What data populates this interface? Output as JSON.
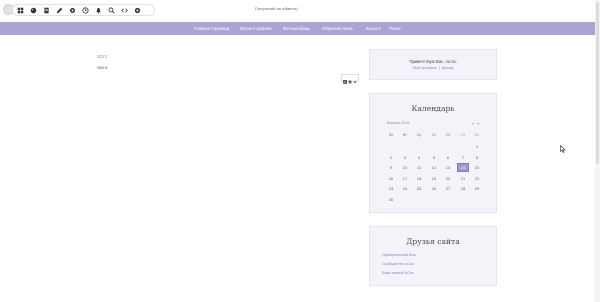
{
  "toolbar": {
    "icons": [
      "dashboard-icon",
      "palette-icon",
      "document-icon",
      "pencil-icon",
      "settings-icon",
      "clock-icon",
      "bell-icon",
      "search-icon",
      "code-icon",
      "eye-icon"
    ],
    "notice": "Получений ни обменіх)"
  },
  "nav": {
    "items": [
      "Главная страница",
      "Каталог файлов",
      "Фотоальбомы",
      "Обратная связь",
      "Каталог",
      "Поиск"
    ]
  },
  "content": {
    "year": "2013",
    "word": "квинк",
    "actions": [
      "rss-icon",
      "print-icon",
      "close-icon"
    ]
  },
  "login": {
    "greeting": "Приветствую Вас, гость!",
    "links": [
      "Мой профиль",
      "|",
      "Выход"
    ]
  },
  "calendar": {
    "title": "Календарь",
    "month": "Апрель 2019",
    "prev": "«",
    "next": "»",
    "weekdays": [
      "Пн",
      "Вт",
      "Ср",
      "Чт",
      "Пт",
      "Сб",
      "Вс"
    ],
    "weeks": [
      [
        "",
        "",
        "",
        "",
        "",
        "",
        "1"
      ],
      [
        "2",
        "3",
        "4",
        "5",
        "6",
        "7",
        "8"
      ],
      [
        "9",
        "10",
        "11",
        "12",
        "13",
        "14",
        "15"
      ],
      [
        "16",
        "17",
        "18",
        "19",
        "20",
        "21",
        "22"
      ],
      [
        "23",
        "24",
        "25",
        "26",
        "27",
        "28",
        "29"
      ],
      [
        "30",
        "",
        "",
        "",
        "",
        "",
        ""
      ]
    ],
    "today": "14"
  },
  "friends": {
    "title": "Друзья сайта",
    "links": [
      "Официальный блог",
      "Сообщество uCoz",
      "База знаний uCoz"
    ]
  },
  "colors": {
    "nav": "#a9a4d3",
    "box_bg": "#f4f3fa",
    "today": "#9f99cf",
    "link": "#8a86b8"
  }
}
